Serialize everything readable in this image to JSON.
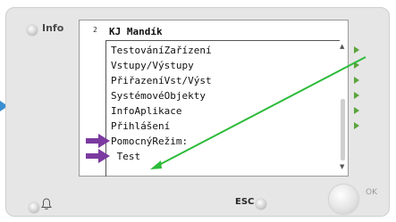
{
  "device": {
    "info_label": "Info",
    "esc_label": "ESC",
    "ok_label": "OK"
  },
  "screen": {
    "page_number": "2",
    "title": "KJ Mandík",
    "menu_items": [
      {
        "label": "TestováníZařízení",
        "has_submenu": true
      },
      {
        "label": "Vstupy/Výstupy",
        "has_submenu": true
      },
      {
        "label": "PřiřazeníVst/Výst",
        "has_submenu": true
      },
      {
        "label": "SystémovéObjekty",
        "has_submenu": true
      },
      {
        "label": "InfoAplikace",
        "has_submenu": true
      },
      {
        "label": "Přihlášení",
        "has_submenu": true
      },
      {
        "label": "PomocnýRežim:",
        "has_submenu": false
      },
      {
        "label": " Test",
        "has_submenu": false
      }
    ]
  },
  "annotations": {
    "marker_color": "#7b3aa0",
    "pointer_color": "#2dbb3a",
    "side_marker_color": "#3a8fd1",
    "menu_arrow_color": "#5aa53a"
  },
  "icons": [
    "info-led-icon",
    "bell-icon",
    "esc-led-icon",
    "ok-knob-icon",
    "scroll-up-icon",
    "scroll-down-icon"
  ]
}
